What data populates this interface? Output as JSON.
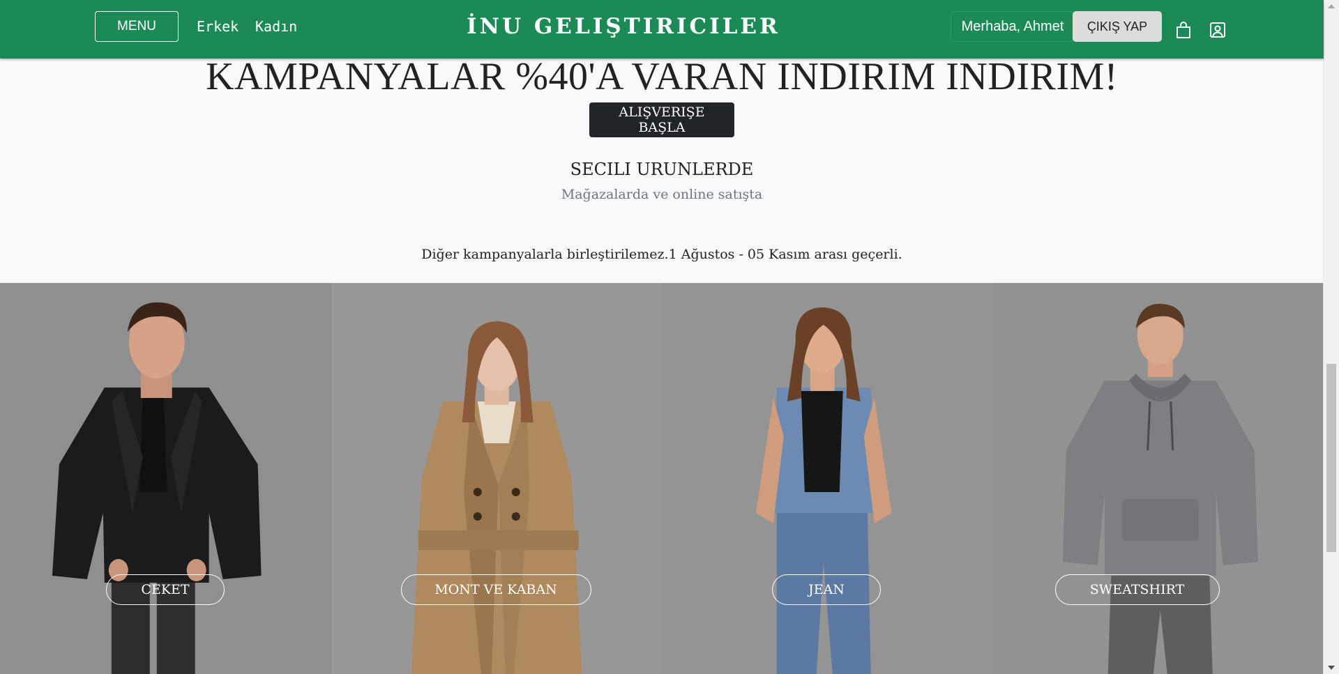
{
  "navbar": {
    "menu_label": "MENU",
    "links": [
      "Erkek",
      "Kadın"
    ],
    "brand": "İNU GELIŞTIRICILER",
    "greeting": "Merhaba, Ahmet",
    "logout_label": "ÇIKIŞ YAP",
    "icons": [
      "shopping-bag-icon",
      "user-profile-icon"
    ],
    "bg_color": "#1c8a56"
  },
  "hero": {
    "title": "KAMPANYALAR %40'A VARAN INDIRIM INDIRIM!",
    "cta_label": "ALIŞVERIŞE BAŞLA",
    "subheading": "SECILI URUNLERDE",
    "subtext": "Mağazalarda ve online satışta",
    "note": "Diğer kampanyalarla birleştirilemez.1 Ağustos - 05 Kasım arası geçerli."
  },
  "categories": [
    {
      "label": "CEKET"
    },
    {
      "label": "MONT VE KABAN"
    },
    {
      "label": "JEAN"
    },
    {
      "label": "SWEATSHIRT"
    }
  ]
}
